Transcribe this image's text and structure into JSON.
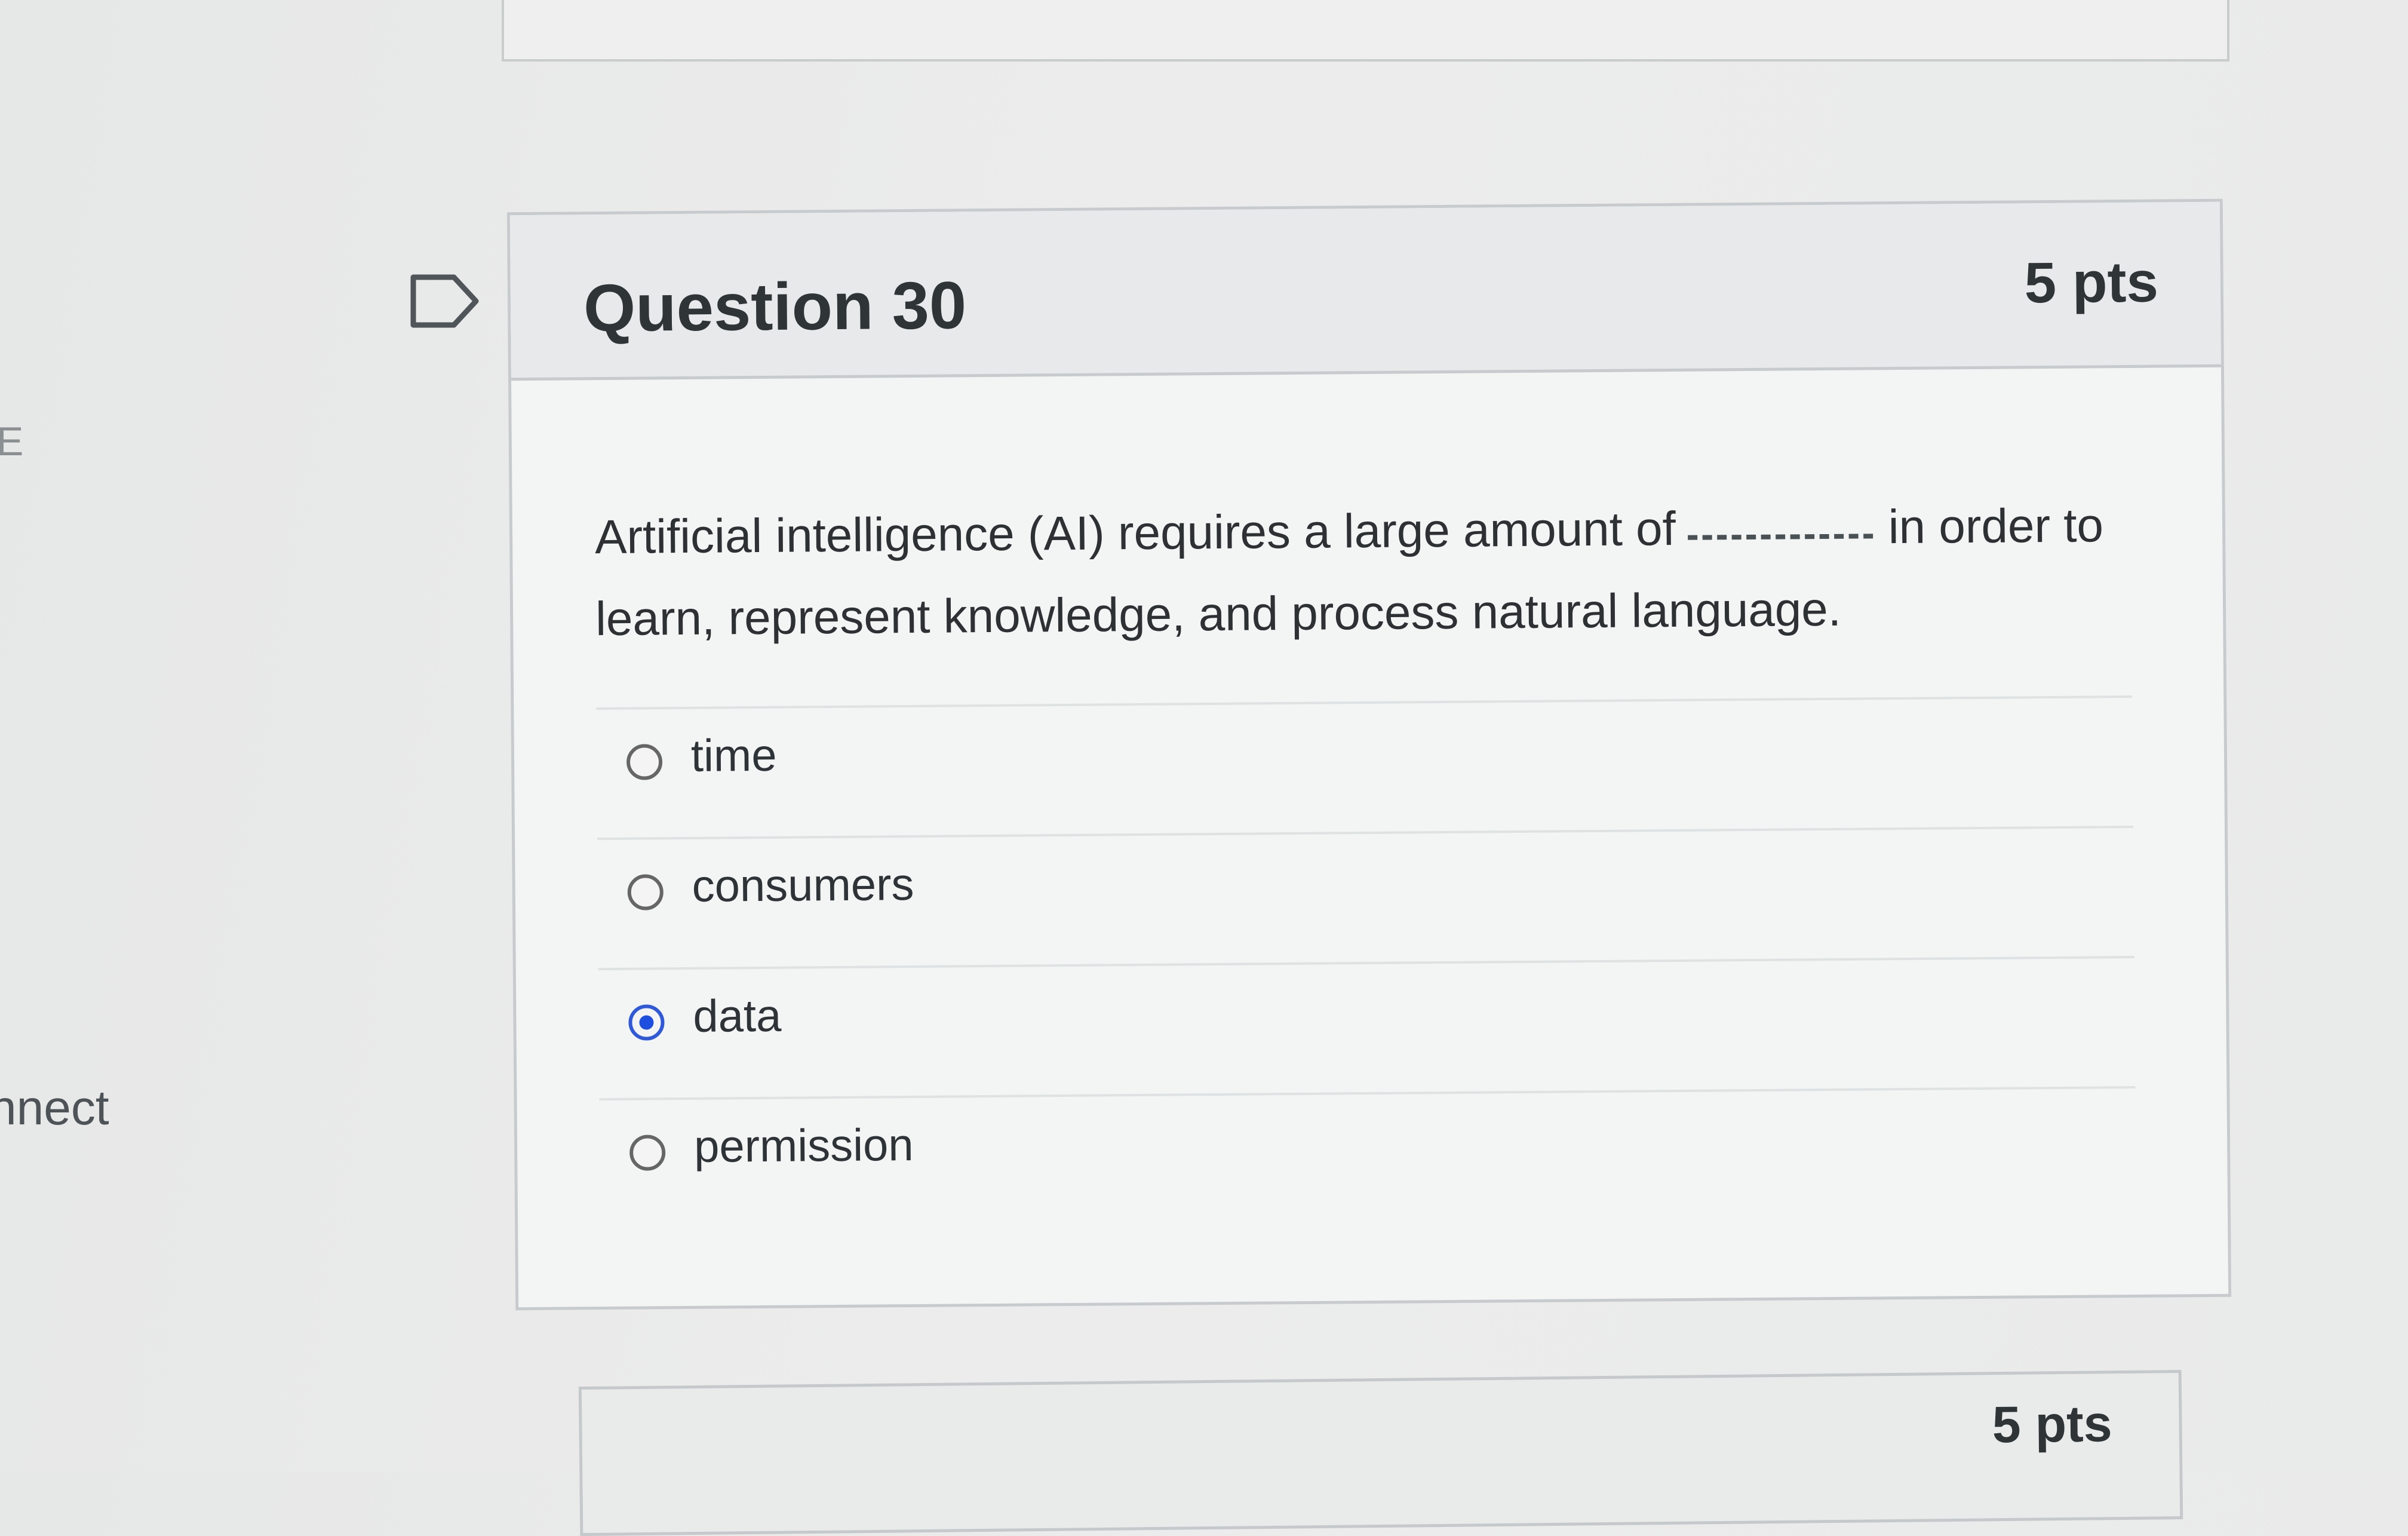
{
  "side": {
    "mark": "E",
    "text": "nnect"
  },
  "question": {
    "title": "Question 30",
    "points": "5 pts",
    "text_before": "Artificial intelligence (AI) requires a large amount of",
    "text_after": "in order to learn, represent knowledge, and process natural language.",
    "answers": [
      {
        "label": "time",
        "selected": false
      },
      {
        "label": "consumers",
        "selected": false
      },
      {
        "label": "data",
        "selected": true
      },
      {
        "label": "permission",
        "selected": false
      }
    ]
  },
  "next_question": {
    "points": "5 pts"
  },
  "icons": {
    "flag": "flag-icon"
  },
  "colors": {
    "selected_radio": "#1d4ee0",
    "border": "#c8cbcd",
    "header": "#e8e9ea"
  }
}
